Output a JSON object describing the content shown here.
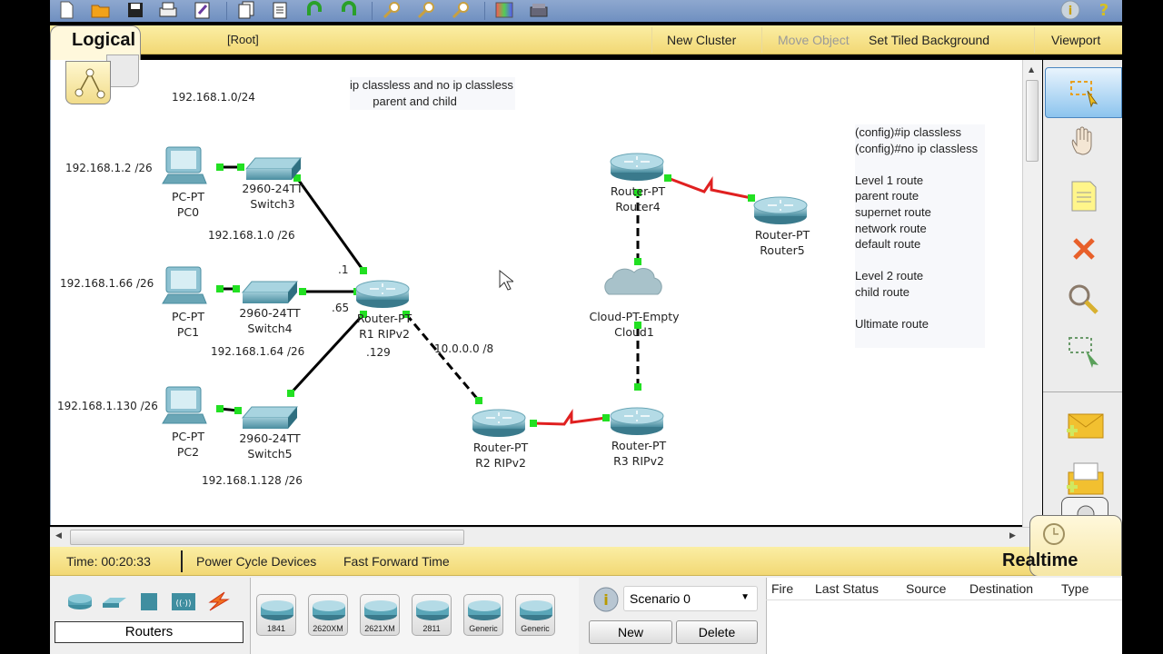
{
  "toolbar": {
    "buttons": [
      {
        "name": "new-file",
        "glyph": "🗋"
      },
      {
        "name": "open-folder",
        "glyph": "📂"
      },
      {
        "name": "save",
        "glyph": "💾"
      },
      {
        "name": "print",
        "glyph": "🖶"
      },
      {
        "name": "activity-wizard",
        "glyph": "✎"
      },
      {
        "name": "copy",
        "glyph": "❐"
      },
      {
        "name": "paste",
        "glyph": "❏"
      },
      {
        "name": "undo",
        "glyph": "↶"
      },
      {
        "name": "redo",
        "glyph": "↷"
      },
      {
        "name": "zoom-in",
        "glyph": "⊕"
      },
      {
        "name": "zoom-reset",
        "glyph": "Ⓡ"
      },
      {
        "name": "zoom-out",
        "glyph": "⊖"
      },
      {
        "name": "palette",
        "glyph": "▦"
      },
      {
        "name": "custom-devices",
        "glyph": "▤"
      }
    ],
    "info_glyph": "i",
    "help_glyph": "?"
  },
  "workspace_bar": {
    "mode_title": "Logical",
    "path": "[Root]",
    "new_cluster": "New Cluster",
    "move_object": "Move Object",
    "set_tiled_background": "Set Tiled Background",
    "viewport": "Viewport"
  },
  "canvas": {
    "labels": {
      "net_top": "192.168.1.0/24",
      "pc0_ip": "192.168.1.2 /26",
      "net_s3": "192.168.1.0 /26",
      "pc1_ip": "192.168.1.66 /26",
      "net_s4": "192.168.1.64 /26",
      "pc2_ip": "192.168.1.130 /26",
      "net_s5": "192.168.1.128 /26",
      "if_1": ".1",
      "if_65": ".65",
      "if_129": ".129",
      "wan": "10.0.0.0 /8"
    },
    "note_top": "ip classless and no ip classless\n       parent and child",
    "note_right": "(config)#ip classless\n(config)#no ip classless\n\nLevel 1 route\nparent route\nsupernet route\nnetwork route\ndefault route\n\nLevel 2 route\nchild route\n\nUltimate route",
    "devices": [
      {
        "id": "pc0",
        "type": "pc",
        "model": "PC-PT",
        "name": "PC0"
      },
      {
        "id": "pc1",
        "type": "pc",
        "model": "PC-PT",
        "name": "PC1"
      },
      {
        "id": "pc2",
        "type": "pc",
        "model": "PC-PT",
        "name": "PC2"
      },
      {
        "id": "sw3",
        "type": "switch",
        "model": "2960-24TT",
        "name": "Switch3"
      },
      {
        "id": "sw4",
        "type": "switch",
        "model": "2960-24TT",
        "name": "Switch4"
      },
      {
        "id": "sw5",
        "type": "switch",
        "model": "2960-24TT",
        "name": "Switch5"
      },
      {
        "id": "r1",
        "type": "router",
        "model": "Router-PT",
        "name": "R1 RIPv2"
      },
      {
        "id": "r2",
        "type": "router",
        "model": "Router-PT",
        "name": "R2 RIPv2"
      },
      {
        "id": "r3",
        "type": "router",
        "model": "Router-PT",
        "name": "R3 RIPv2"
      },
      {
        "id": "r4",
        "type": "router",
        "model": "Router-PT",
        "name": "Router4"
      },
      {
        "id": "r5",
        "type": "router",
        "model": "Router-PT",
        "name": "Router5"
      },
      {
        "id": "cloud1",
        "type": "cloud",
        "model": "Cloud-PT-Empty",
        "name": "Cloud1"
      }
    ],
    "links": [
      {
        "from": "pc0",
        "to": "sw3",
        "kind": "straight"
      },
      {
        "from": "pc1",
        "to": "sw4",
        "kind": "straight"
      },
      {
        "from": "pc2",
        "to": "sw5",
        "kind": "straight"
      },
      {
        "from": "sw3",
        "to": "r1",
        "kind": "straight"
      },
      {
        "from": "sw4",
        "to": "r1",
        "kind": "straight"
      },
      {
        "from": "sw5",
        "to": "r1",
        "kind": "straight"
      },
      {
        "from": "r1",
        "to": "r2",
        "kind": "crossover"
      },
      {
        "from": "r2",
        "to": "r3",
        "kind": "serial"
      },
      {
        "from": "r3",
        "to": "cloud1",
        "kind": "crossover"
      },
      {
        "from": "cloud1",
        "to": "r4",
        "kind": "crossover"
      },
      {
        "from": "r4",
        "to": "r5",
        "kind": "serial"
      }
    ],
    "colors": {
      "link_up": "#22e022",
      "serial": "#e02020",
      "cable": "#000000"
    }
  },
  "tools": [
    {
      "name": "select",
      "glyph": "⬚",
      "active": true
    },
    {
      "name": "move-layout",
      "glyph": "✋",
      "active": false
    },
    {
      "name": "place-note",
      "glyph": "🗒",
      "active": false
    },
    {
      "name": "delete",
      "glyph": "✖",
      "active": false
    },
    {
      "name": "inspect",
      "glyph": "🔍",
      "active": false
    },
    {
      "name": "resize-shape",
      "glyph": "⬚",
      "active": false
    },
    {
      "name": "add-simple-pdu",
      "glyph": "✉",
      "active": false
    },
    {
      "name": "add-complex-pdu",
      "glyph": "✉",
      "active": false
    }
  ],
  "status_bar": {
    "time": "Time: 00:20:33",
    "power_cycle": "Power Cycle Devices",
    "fast_forward": "Fast Forward Time",
    "mode": "Realtime"
  },
  "device_panel": {
    "category": "Routers",
    "categories": [
      "routers",
      "switches",
      "hubs",
      "wireless",
      "connections"
    ],
    "models": [
      "1841",
      "2620XM",
      "2621XM",
      "2811",
      "Generic",
      "Generic"
    ]
  },
  "scenario": {
    "selected": "Scenario 0",
    "new_label": "New",
    "delete_label": "Delete"
  },
  "pdu_table": {
    "columns": [
      "Fire",
      "Last Status",
      "Source",
      "Destination",
      "Type"
    ]
  }
}
